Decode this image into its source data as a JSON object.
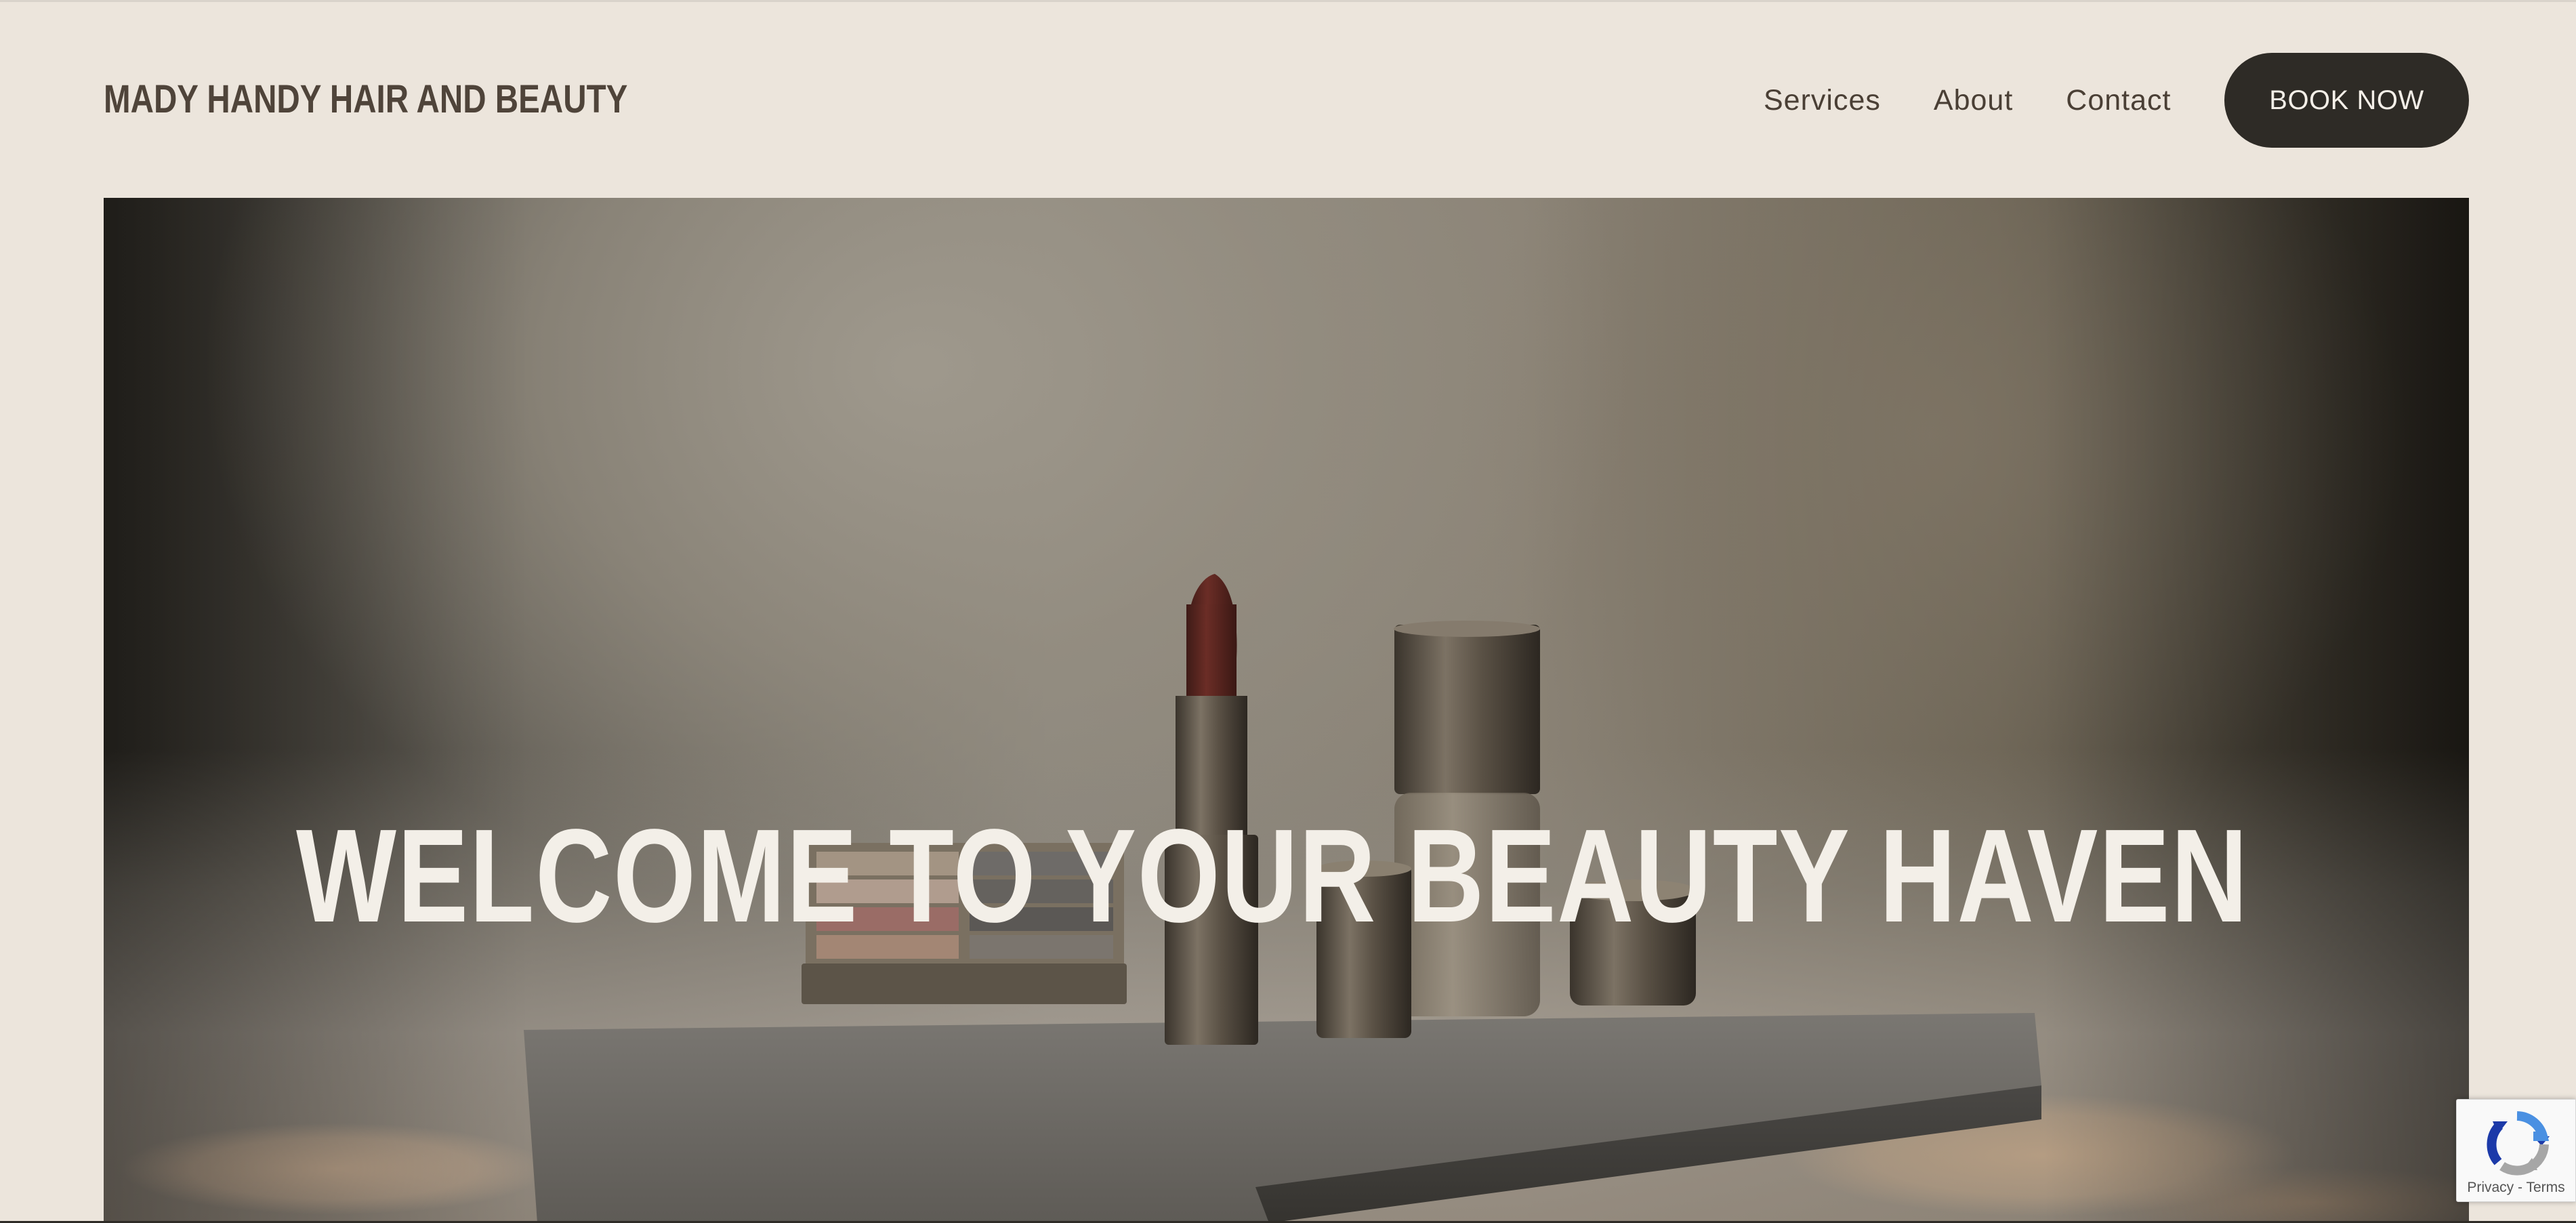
{
  "brand": {
    "name": "MADY HANDY HAIR AND BEAUTY"
  },
  "nav": {
    "items": [
      {
        "label": "Services"
      },
      {
        "label": "About"
      },
      {
        "label": "Contact"
      }
    ],
    "cta_label": "BOOK NOW"
  },
  "hero": {
    "title": "WELCOME TO YOUR BEAUTY HAVEN",
    "image_alt": "cosmetics on a stone plinth"
  },
  "recaptcha": {
    "privacy_label": "Privacy",
    "separator": " - ",
    "terms_label": "Terms"
  },
  "colors": {
    "background": "#ece5dc",
    "brand_text": "#4f443a",
    "button_bg": "#2e2b26",
    "button_text": "#f4efe8",
    "hero_title": "#f3efe8"
  }
}
